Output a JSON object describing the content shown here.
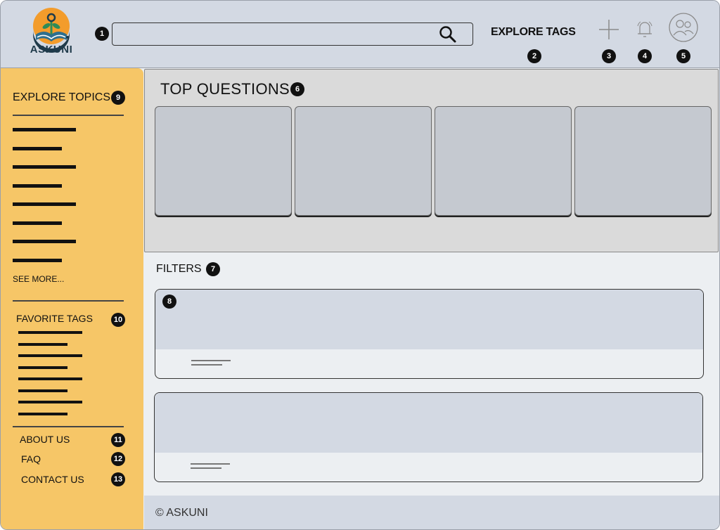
{
  "brand": {
    "name": "ASKUNI"
  },
  "header": {
    "search": {
      "placeholder": ""
    },
    "explore_tags_label": "EXPLORE TAGS",
    "icons": [
      "plus-icon",
      "bell-icon",
      "user-profile-icon"
    ]
  },
  "badges": [
    "1",
    "2",
    "3",
    "4",
    "5",
    "6",
    "7",
    "8",
    "9",
    "10",
    "11",
    "12",
    "13"
  ],
  "sidebar": {
    "explore_topics_title": "EXPLORE TOPICS",
    "see_more_label": "SEE MORE...",
    "favorite_tags_title": "FAVORITE TAGS",
    "links": {
      "about": "ABOUT US",
      "faq": "FAQ",
      "contact": "CONTACT US"
    }
  },
  "main": {
    "top_questions_title": "TOP QUESTIONS",
    "filters_label": "FILTERS"
  },
  "footer": {
    "copyright": "© ASKUNI"
  },
  "colors": {
    "sidebar": "#f6c667",
    "header": "#d3d9e3",
    "top_questions_bg": "#dadada",
    "card": "#c5c9d0"
  }
}
